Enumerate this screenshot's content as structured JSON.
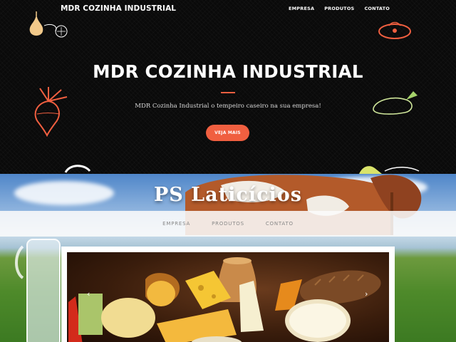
{
  "header": {
    "brand": "MDR COZINHA INDUSTRIAL",
    "nav": [
      {
        "label": "EMPRESA"
      },
      {
        "label": "PRODUTOS"
      },
      {
        "label": "CONTATO"
      }
    ]
  },
  "hero": {
    "title": "MDR COZINHA INDUSTRIAL",
    "subtitle": "MDR Cozinha Industrial o tempeiro caseiro na sua empresa!",
    "button_label": "VEJA MAIS"
  },
  "section2": {
    "title": "PS Laticícios",
    "nav": [
      {
        "label": "EMPRESA"
      },
      {
        "label": "PRODUTOS"
      },
      {
        "label": "CONTATO"
      }
    ],
    "carousel": {
      "prev_icon": "chevron-left-icon",
      "next_icon": "chevron-right-icon",
      "prev_glyph": "‹",
      "next_glyph": "›"
    }
  },
  "colors": {
    "accent": "#f05f40",
    "hero_bg": "#0a0a0a"
  }
}
